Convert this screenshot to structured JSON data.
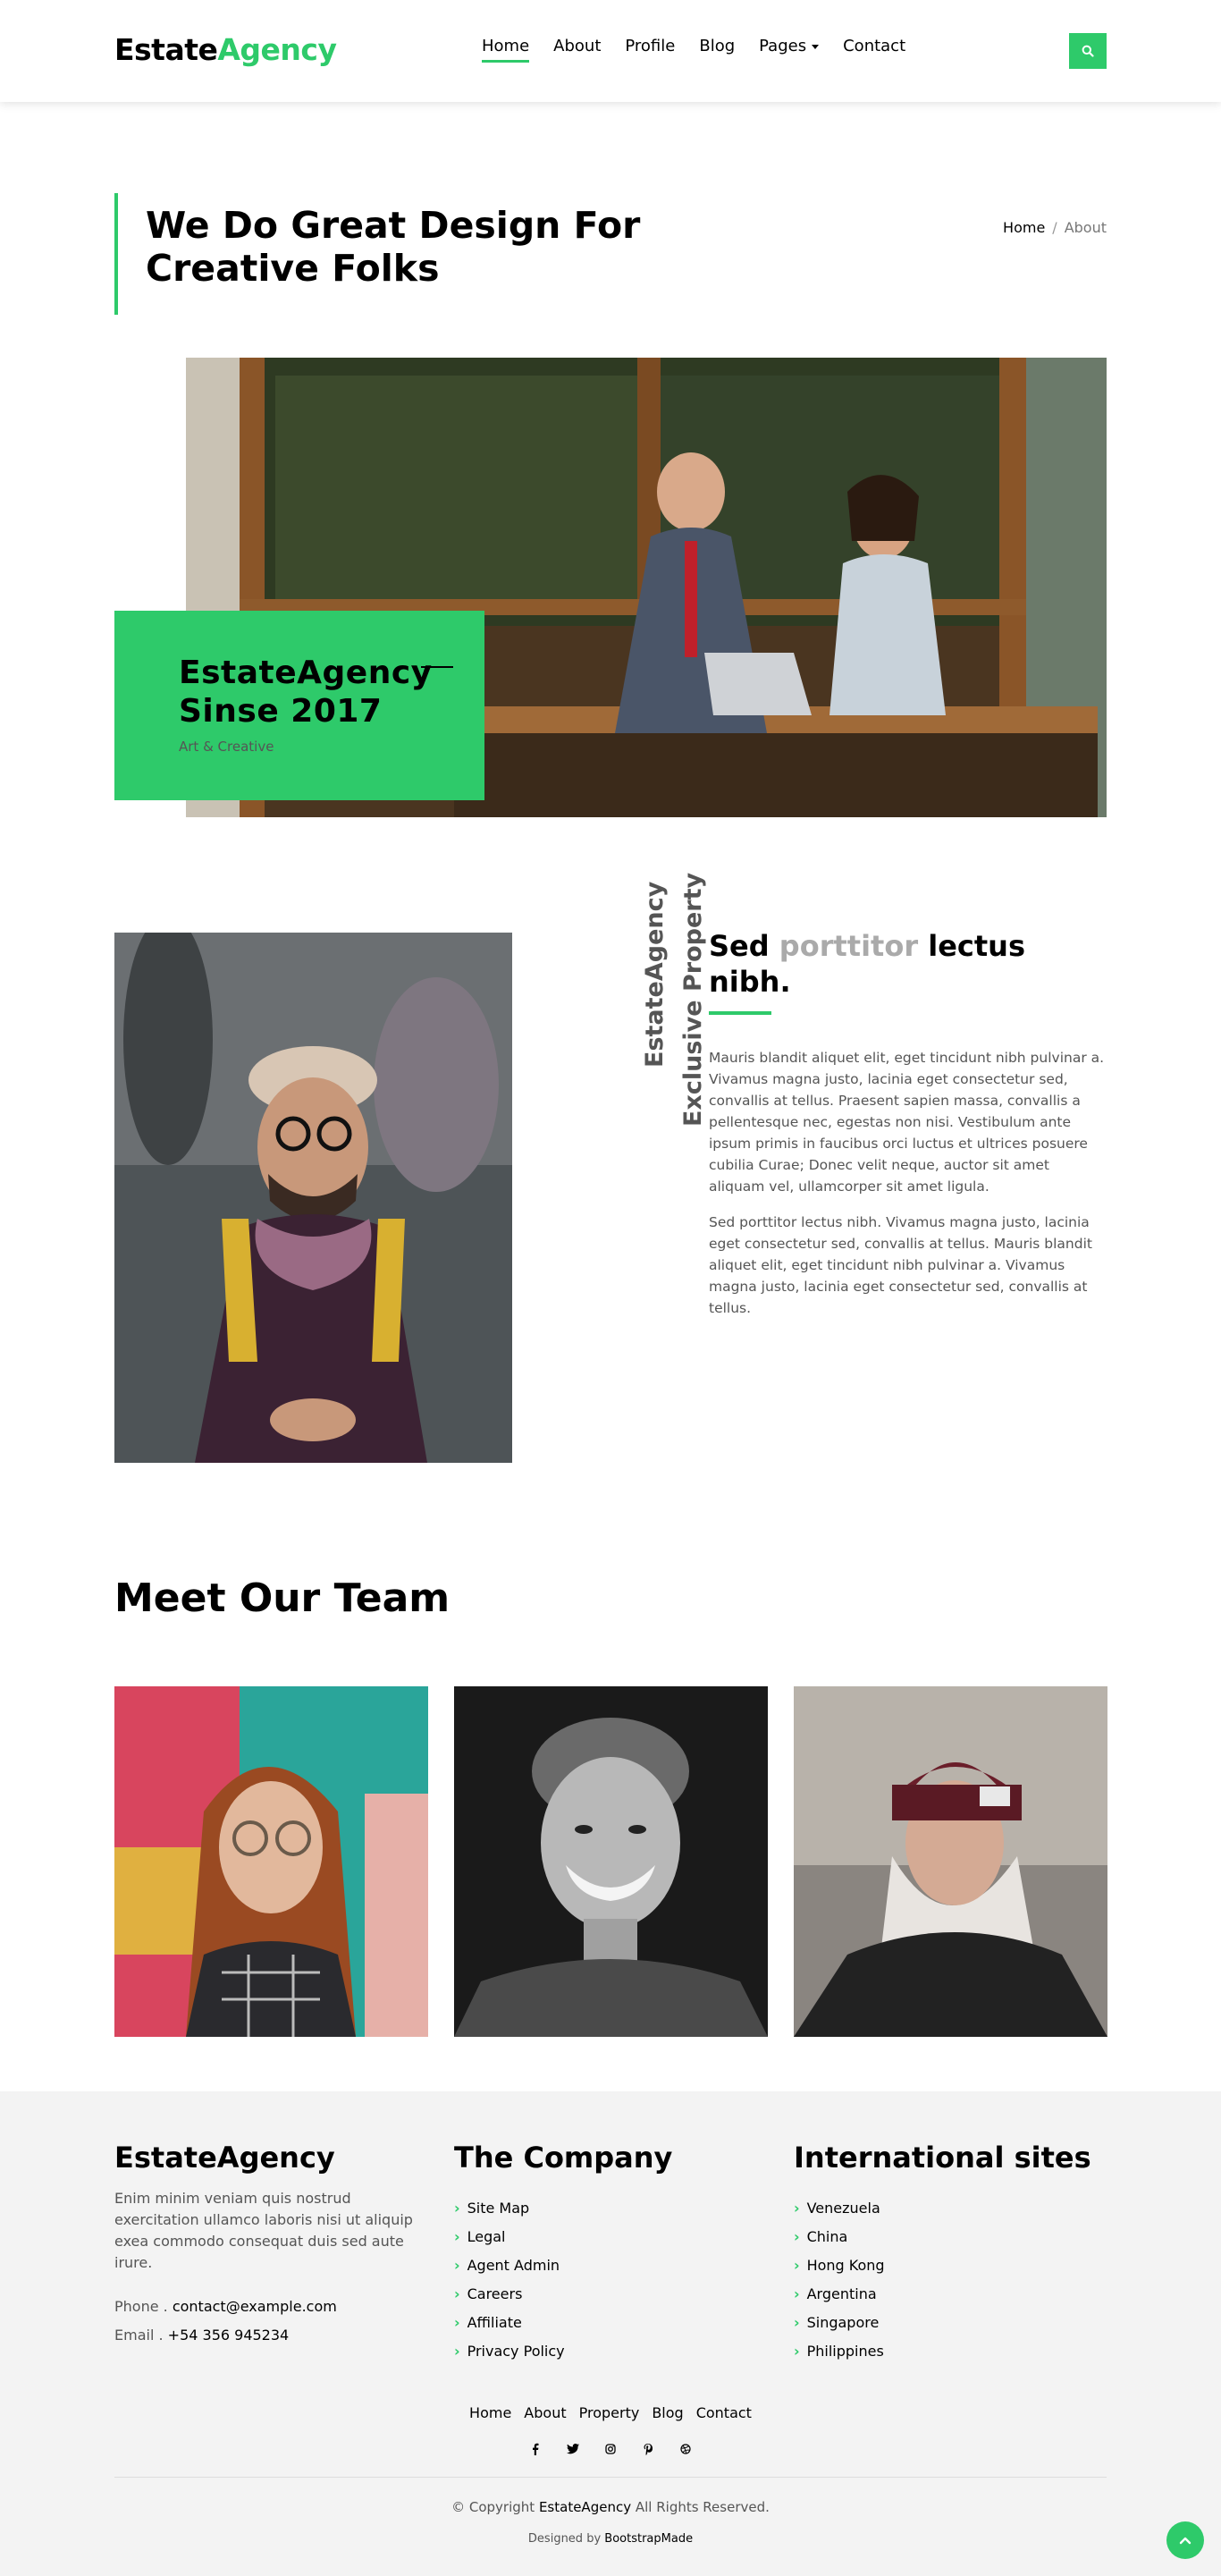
{
  "nav": {
    "brand_main": "Estate",
    "brand_accent": "Agency",
    "links": [
      "Home",
      "About",
      "Profile",
      "Blog",
      "Pages",
      "Contact"
    ],
    "active": "Home",
    "accent_color": "#2eca6a"
  },
  "intro": {
    "title": "We Do Great Design For Creative Folks",
    "breadcrumb_home": "Home",
    "breadcrumb_sep": "/",
    "breadcrumb_current": "About"
  },
  "hero_box": {
    "title_line1": "EstateAgency",
    "title_line2": "Sinse 2017",
    "subtitle": "Art & Creative"
  },
  "about": {
    "vertical_1": "EstateAgency",
    "vertical_2": "Exclusive Property",
    "title_part1": "Sed",
    "title_highlight": "porttitor",
    "title_part2": "lectus nibh.",
    "p1": "Mauris blandit aliquet elit, eget tincidunt nibh pulvinar a. Vivamus magna justo, lacinia eget consectetur sed, convallis at tellus. Praesent sapien massa, convallis a pellentesque nec, egestas non nisi. Vestibulum ante ipsum primis in faucibus orci luctus et ultrices posuere cubilia Curae; Donec velit neque, auctor sit amet aliquam vel, ullamcorper sit amet ligula.",
    "p2": "Sed porttitor lectus nibh. Vivamus magna justo, lacinia eget consectetur sed, convallis at tellus. Mauris blandit aliquet elit, eget tincidunt nibh pulvinar a. Vivamus magna justo, lacinia eget consectetur sed, convallis at tellus."
  },
  "team": {
    "title": "Meet Our Team"
  },
  "footer": {
    "col1_title": "EstateAgency",
    "col1_desc": "Enim minim veniam quis nostrud exercitation ullamco laboris nisi ut aliquip exea commodo consequat duis sed aute irure.",
    "phone_label": "Phone .",
    "phone_value": "contact@example.com",
    "email_label": "Email .",
    "email_value": "+54 356 945234",
    "col2_title": "The Company",
    "col2_links": [
      "Site Map",
      "Legal",
      "Agent Admin",
      "Careers",
      "Affiliate",
      "Privacy Policy"
    ],
    "col3_title": "International sites",
    "col3_links": [
      "Venezuela",
      "China",
      "Hong Kong",
      "Argentina",
      "Singapore",
      "Philippines"
    ],
    "bottom_nav": [
      "Home",
      "About",
      "Property",
      "Blog",
      "Contact"
    ],
    "social_icons": [
      "facebook-icon",
      "twitter-icon",
      "instagram-icon",
      "pinterest-icon",
      "dribbble-icon"
    ],
    "copyright_pre": "© Copyright",
    "copyright_brand": "EstateAgency",
    "copyright_post": "All Rights Reserved.",
    "designed_by_label": "Designed by",
    "designed_by": "BootstrapMade"
  }
}
